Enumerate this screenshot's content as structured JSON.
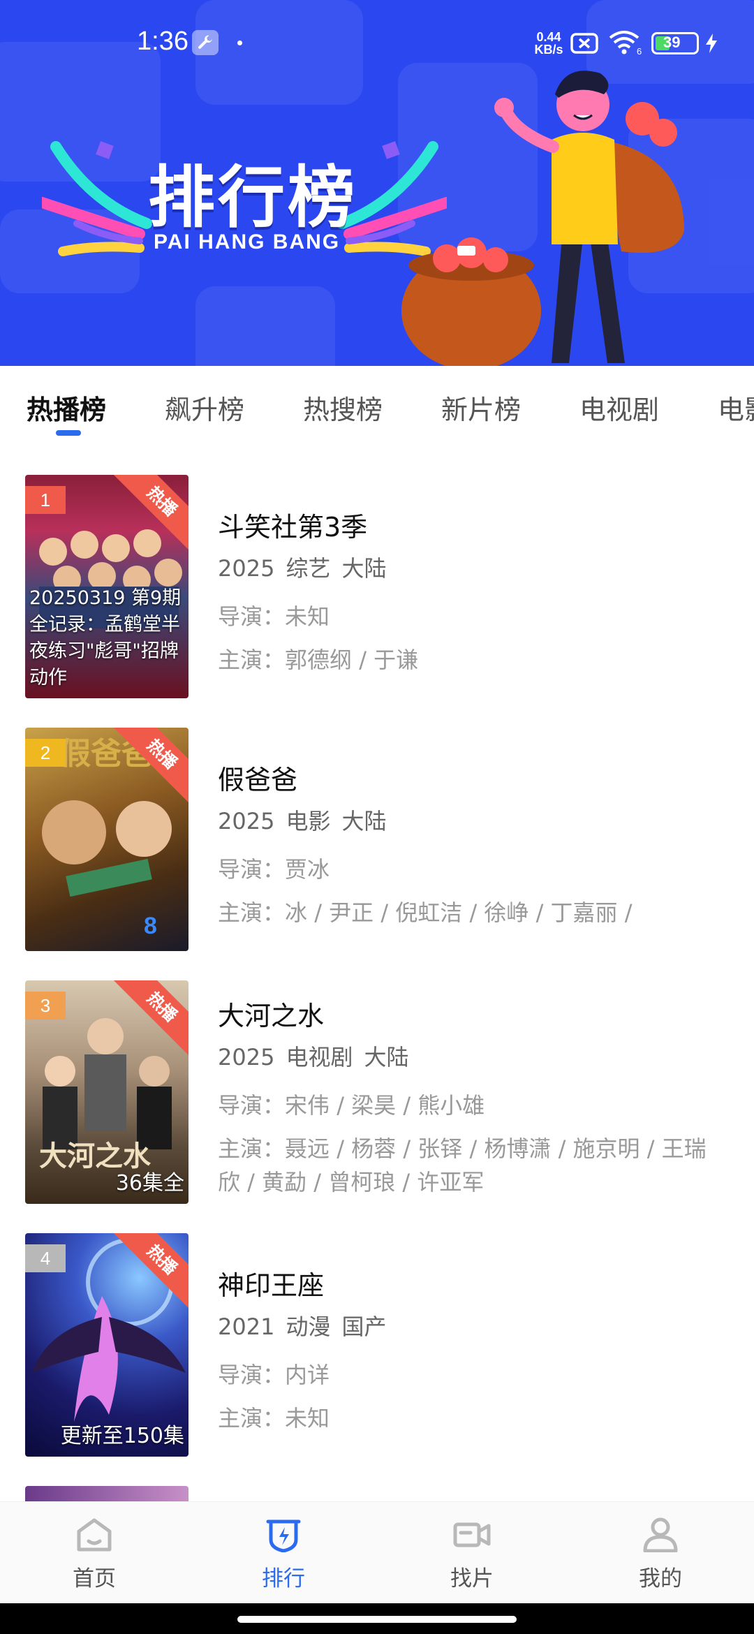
{
  "status_bar": {
    "time": "1:36",
    "net_speed_value": "0.44",
    "net_speed_unit": "KB/s",
    "battery": "39"
  },
  "banner": {
    "title": "排行榜",
    "subtitle": "PAI HANG BANG",
    "bg_color": "#2b48f0"
  },
  "tabs": [
    {
      "label": "热播榜"
    },
    {
      "label": "飙升榜"
    },
    {
      "label": "热搜榜"
    },
    {
      "label": "新片榜"
    },
    {
      "label": "电视剧"
    },
    {
      "label": "电影"
    }
  ],
  "accent_color": "#2b6bf0",
  "items": [
    {
      "rank": "1",
      "badge": "热播",
      "poster_caption": "20250319 第9期全记录：孟鹤堂半夜练习\"彪哥\"招牌动作",
      "title": "斗笑社第3季",
      "year": "2025",
      "genre": "综艺",
      "region": "大陆",
      "director_label": "导演：",
      "director": "未知",
      "cast_label": "主演：",
      "cast": "郭德纲 / 于谦"
    },
    {
      "rank": "2",
      "badge": "热播",
      "poster_caption": "",
      "title": "假爸爸",
      "year": "2025",
      "genre": "电影",
      "region": "大陆",
      "director_label": "导演：",
      "director": "贾冰",
      "cast_label": "主演：",
      "cast": "冰 / 尹正 / 倪虹洁 / 徐峥 / 丁嘉丽 /"
    },
    {
      "rank": "3",
      "badge": "热播",
      "poster_caption": "36集全",
      "title": "大河之水",
      "year": "2025",
      "genre": "电视剧",
      "region": "大陆",
      "director_label": "导演：",
      "director": "宋伟 / 梁昊 / 熊小雄",
      "cast_label": "主演：",
      "cast": "聂远 / 杨蓉 / 张铎 / 杨博潇 / 施京明 / 王瑞欣 / 黄勐 / 曾柯琅 / 许亚军"
    },
    {
      "rank": "4",
      "badge": "热播",
      "poster_caption": "更新至150集",
      "title": "神印王座",
      "year": "2021",
      "genre": "动漫",
      "region": "国产",
      "director_label": "导演：",
      "director": "内详",
      "cast_label": "主演：",
      "cast": "未知"
    }
  ],
  "bottom_nav": [
    {
      "label": "首页",
      "icon": "home-icon"
    },
    {
      "label": "排行",
      "icon": "ranking-icon"
    },
    {
      "label": "找片",
      "icon": "video-camera-icon"
    },
    {
      "label": "我的",
      "icon": "user-icon"
    }
  ]
}
